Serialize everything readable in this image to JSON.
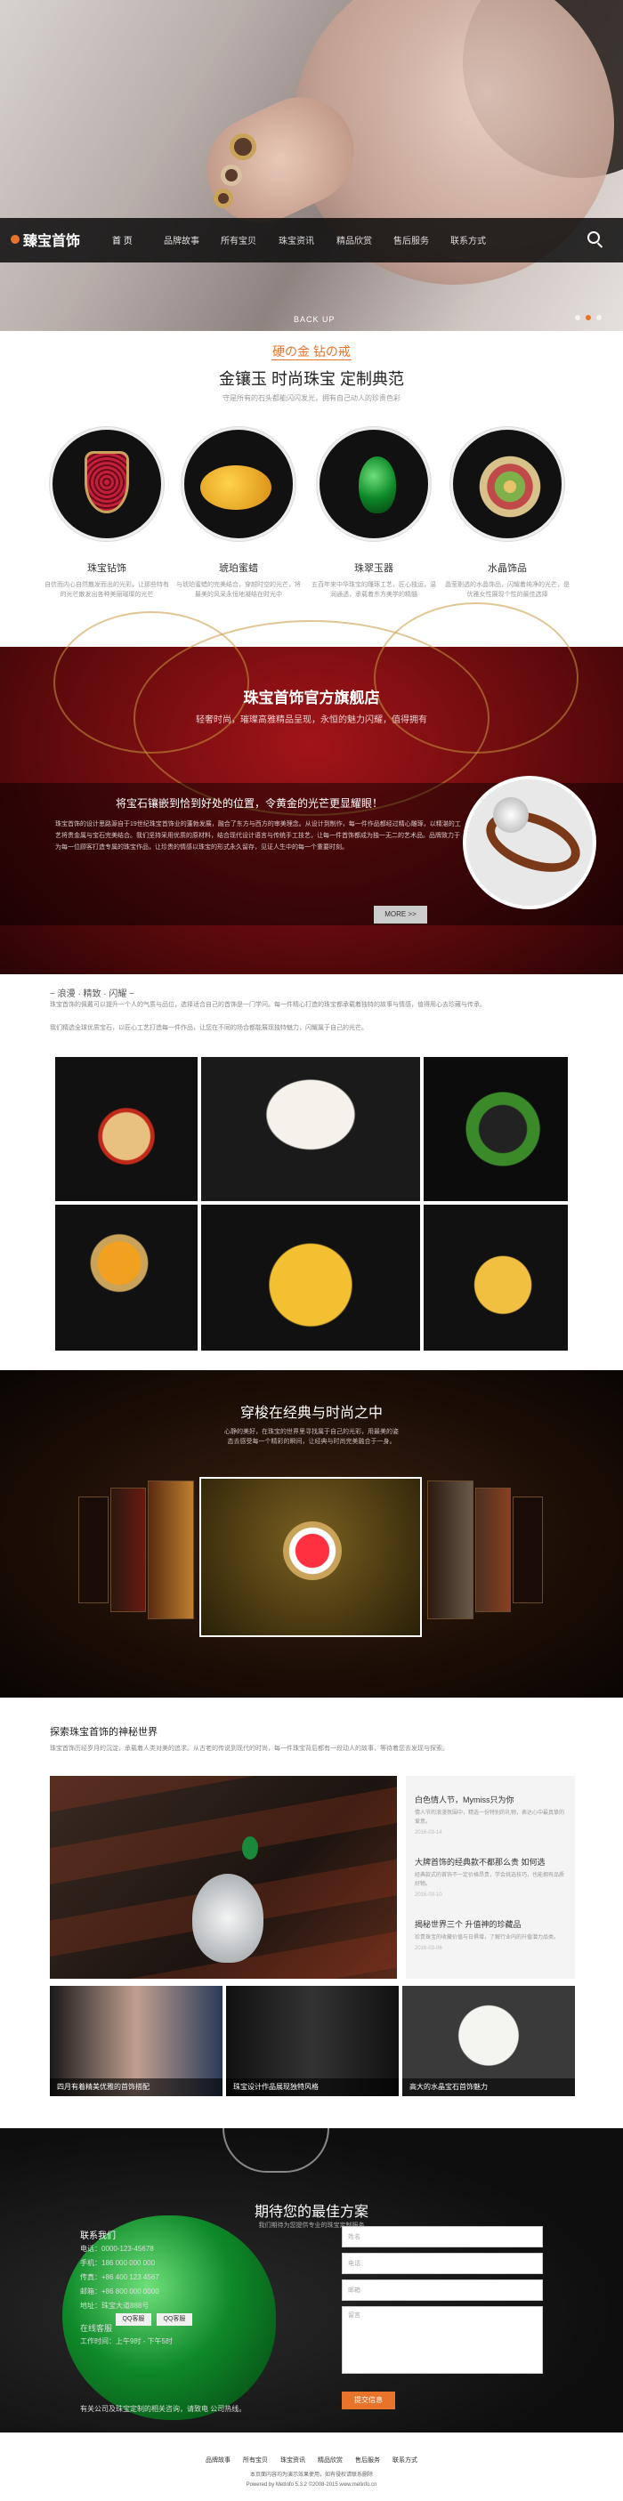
{
  "brand": {
    "name": "臻宝首饰",
    "accent": "#e8742c"
  },
  "nav": {
    "items": [
      "首 页",
      "品牌故事",
      "所有宝贝",
      "珠宝资讯",
      "精品欣赏",
      "售后服务",
      "联系方式"
    ]
  },
  "hero": {
    "back_up": "BACK UP"
  },
  "intro": {
    "tagline": "硬の金 钻の戒",
    "title": "金镶玉 时尚珠宝 定制典范",
    "sub": "守是所有的石头都能闪闪发光，拥有自己动人的珍贵色彩",
    "items": [
      {
        "title": "珠宝钻饰",
        "desc": "自信而内心自然散发而出的光彩，让那些特有的光芒散发出各种美丽璀璨的光芒"
      },
      {
        "title": "琥珀蜜蜡",
        "desc": "与琥珀蜜蜡的完美结合，穿越时空的光芒，将最美的风采永恒地凝结在时光中"
      },
      {
        "title": "珠翠玉器",
        "desc": "五百年来中华珠宝的雕琢工艺，匠心独运，温润通透，承载着东方美学的精髓"
      },
      {
        "title": "水晶饰品",
        "desc": "晶莹剔透的水晶饰品，闪耀着纯净的光芒，是优雅女性展现个性的最佳选择"
      }
    ]
  },
  "banner": {
    "title": "珠宝首饰官方旗舰店",
    "slogan": "轻奢时尚，璀璨高雅精品呈现，永恒的魅力闪耀，值得拥有",
    "headline": "将宝石镶嵌到恰到好处的位置，令黄金的光芒更显耀眼！",
    "body": "珠宝首饰的设计思路源自于19世纪珠宝首饰业的蓬勃发展，融合了东方与西方的审美理念。从设计到制作，每一件作品都经过精心雕琢，以精湛的工艺将贵金属与宝石完美结合。我们坚持采用优质的原材料，结合现代设计语言与传统手工技艺，让每一件首饰都成为独一无二的艺术品。品牌致力于为每一位顾客打造专属的珠宝作品，让珍贵的情感以珠宝的形式永久留存，见证人生中的每一个重要时刻。",
    "more": "MORE >>"
  },
  "story": {
    "title": "~ 浪漫 · 精致 · 闪耀 ~",
    "p1": "珠宝首饰的佩戴可以提升一个人的气质与品位，选择适合自己的首饰是一门学问。每一件精心打造的珠宝都承载着独特的故事与情感，值得用心去珍藏与传承。",
    "p2": "我们精选全球优质宝石，以匠心工艺打造每一件作品，让您在不同的场合都能展现独特魅力，闪耀属于自己的光芒。"
  },
  "showcase": {
    "title": "穿梭在经典与时尚之中",
    "desc": "心静的美好，在珠宝的世界里寻找属于自己的光彩，用最美的姿态去感受每一个精彩的瞬间，让经典与时尚完美融合于一身。"
  },
  "news": {
    "title": "探索珠宝首饰的神秘世界",
    "intro": "珠宝首饰历经岁月的沉淀，承载着人类对美的追求。从古老的传说到现代的时尚，每一件珠宝背后都有一段动人的故事，等待着您去发现与探索。",
    "items": [
      {
        "title": "白色情人节，Mymiss只为你",
        "desc": "情人节的浪漫氛围中，精选一份特别的礼物，表达心中最真挚的爱意。",
        "date": "2016-03-14"
      },
      {
        "title": "大牌首饰的经典款不都那么贵 如何选",
        "desc": "经典款式的首饰不一定价格昂贵，学会挑选技巧，也能拥有品质好物。",
        "date": "2016-03-10"
      },
      {
        "title": "揭秘世界三个 升值神的珍藏品",
        "desc": "珍贵珠宝的收藏价值与日俱增，了解行业内的升值潜力品类。",
        "date": "2016-03-06"
      }
    ],
    "thumbs": [
      "四月有着精美优雅的首饰搭配",
      "珠宝设计作品展现独特风格",
      "高大的水晶宝石首饰魅力"
    ]
  },
  "contact": {
    "title": "期待您的最佳方案",
    "sub": "我们期待为您提供专业的珠宝定制服务",
    "heading": "联系我们",
    "lines": [
      "电话：0000-123-45678",
      "手机：186 000 000 000",
      "传真：+86 400 123 4567",
      "邮箱：+86 800 000 0000",
      "地址：珠宝大道888号"
    ],
    "online": "在线客服",
    "hours": "工作时间：上午9时 - 下午5时",
    "qq": [
      "QQ客服",
      "QQ客服"
    ],
    "bottom": "有关公司及珠宝定制的相关咨询，请致电 公司热线。",
    "fields": [
      "姓名",
      "电话",
      "邮箱",
      "留言"
    ],
    "submit": "提交信息"
  },
  "footer": {
    "links": [
      "品牌故事",
      "所有宝贝",
      "珠宝资讯",
      "精品欣赏",
      "售后服务",
      "联系方式"
    ],
    "line1": "本页面内容均为演示效果使用，如有侵权请联系删除",
    "line2": "Powered by MetInfo 5.3.2 ©2008-2015 www.metinfo.cn"
  }
}
